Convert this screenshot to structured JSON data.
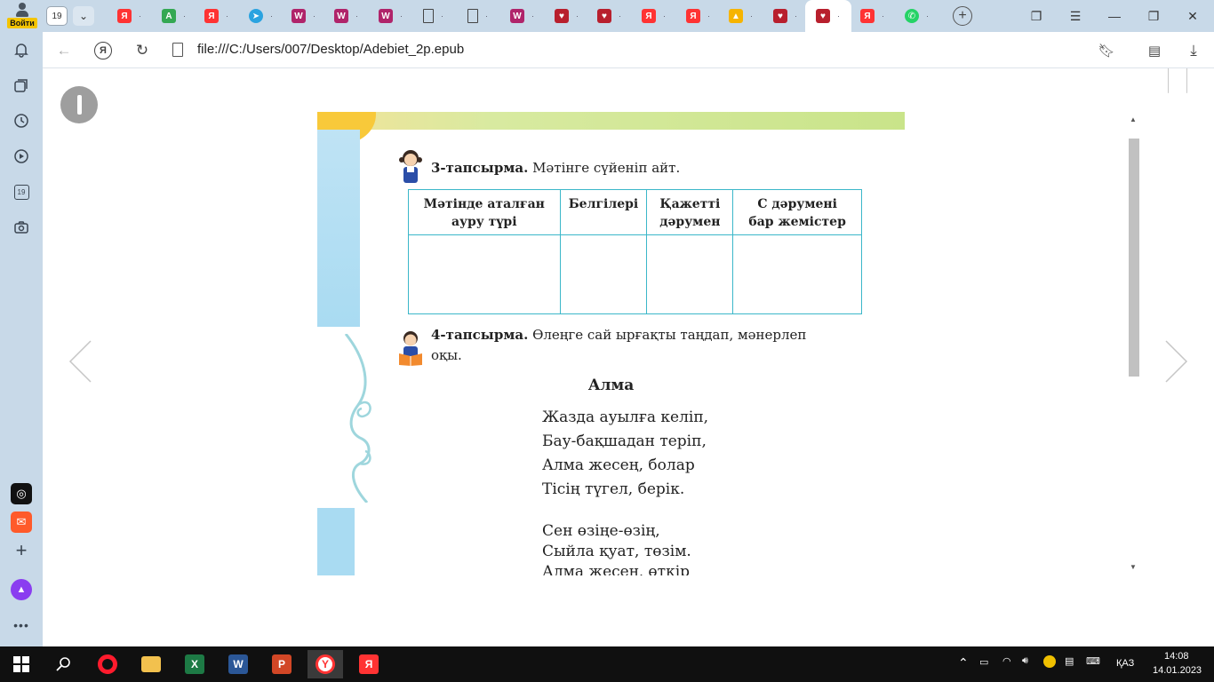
{
  "browser": {
    "login_label": "Войти",
    "tab_count": "19",
    "url": "file:///C:/Users/007/Desktop/Adebiet_2p.epub",
    "tabs": [
      {
        "icon": "yandex-icon",
        "glyph": "Я",
        "cls": "y"
      },
      {
        "icon": "android-icon",
        "glyph": "A",
        "cls": "a"
      },
      {
        "icon": "yandex-icon",
        "glyph": "Я",
        "cls": "y"
      },
      {
        "icon": "telegram-icon",
        "glyph": "➤",
        "cls": "tg"
      },
      {
        "icon": "wildberries-icon",
        "glyph": "W",
        "cls": "w"
      },
      {
        "icon": "wildberries-icon",
        "glyph": "W",
        "cls": "w"
      },
      {
        "icon": "wildberries-icon",
        "glyph": "W",
        "cls": "w"
      },
      {
        "icon": "document-icon",
        "glyph": "",
        "cls": "doc"
      },
      {
        "icon": "document-icon",
        "glyph": "",
        "cls": "doc"
      },
      {
        "icon": "wildberries-icon",
        "glyph": "W",
        "cls": "w"
      },
      {
        "icon": "shield-icon",
        "glyph": "♥",
        "cls": "sh"
      },
      {
        "icon": "shield-icon",
        "glyph": "♥",
        "cls": "sh"
      },
      {
        "icon": "yandex-icon",
        "glyph": "Я",
        "cls": "y"
      },
      {
        "icon": "yandex-icon",
        "glyph": "Я",
        "cls": "y"
      },
      {
        "icon": "image-icon",
        "glyph": "▲",
        "cls": "img"
      },
      {
        "icon": "shield-icon",
        "glyph": "♥",
        "cls": "sh"
      },
      {
        "icon": "shield-icon",
        "glyph": "♥",
        "cls": "sh"
      },
      {
        "icon": "yandex-icon",
        "glyph": "Я",
        "cls": "y"
      },
      {
        "icon": "whatsapp-icon",
        "glyph": "✆",
        "cls": "wa"
      }
    ]
  },
  "epub": {
    "task3": {
      "label": "3-тапсырма.",
      "text": " Мәтінге сүйеніп айт."
    },
    "table_headers": [
      [
        "Мәтінде аталған",
        "ауру түрі"
      ],
      [
        "Белгілері",
        ""
      ],
      [
        "Қажетті",
        "дәрумен"
      ],
      [
        "С дәрумені",
        "бар жемістер"
      ]
    ],
    "task4": {
      "label": "4-тапсырма.",
      "text_line1": " Өлеңге сай ырғақты таңдап, мәнерлеп",
      "text_line2": "оқы."
    },
    "poem": {
      "title": "Алма",
      "lines": [
        "Жазда ауылға келіп,",
        "Бау-бақшадан теріп,",
        "Алма жесең, болар",
        "Тісің түгел, берік.",
        "Сен өзіңе-өзің,",
        "Сыйла қуат, төзім.",
        "Алма жесең, өткір"
      ]
    }
  },
  "taskbar": {
    "language": "ҚАЗ",
    "time": "14:08",
    "date": "14.01.2023"
  }
}
